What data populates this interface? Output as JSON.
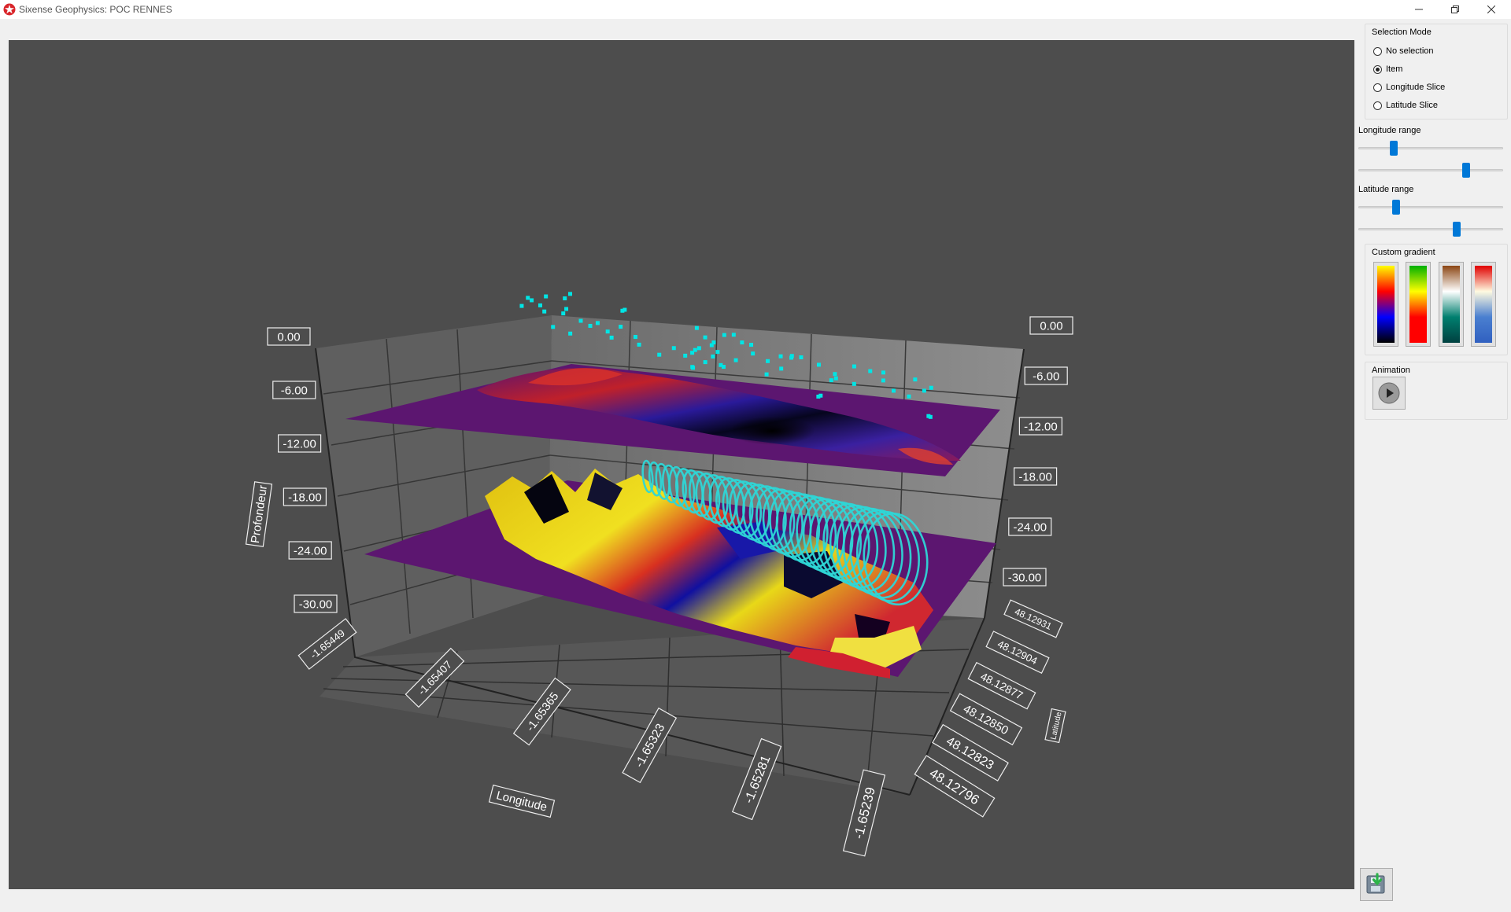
{
  "window": {
    "title": "Sixense Geophysics: POC RENNES"
  },
  "selection": {
    "title": "Selection Mode",
    "options": [
      {
        "label": "No selection",
        "checked": false
      },
      {
        "label": "Item",
        "checked": true
      },
      {
        "label": "Longitude Slice",
        "checked": false
      },
      {
        "label": "Latitude Slice",
        "checked": false
      }
    ]
  },
  "longitude_range": {
    "label": "Longitude range"
  },
  "latitude_range": {
    "label": "Latitude range"
  },
  "gradient": {
    "title": "Custom gradient",
    "swatches": [
      {
        "name": "gradient-hot",
        "colors": [
          "#ffff00",
          "#ff0000",
          "#0000ff",
          "#000000"
        ]
      },
      {
        "name": "gradient-green-red",
        "colors": [
          "#00b000",
          "#ffff00",
          "#ff0000",
          "#ff0000"
        ]
      },
      {
        "name": "gradient-brown-teal",
        "colors": [
          "#8b4513",
          "#ffffff",
          "#007f6f",
          "#004040"
        ]
      },
      {
        "name": "gradient-red-blue",
        "colors": [
          "#e00000",
          "#fffae0",
          "#4a7fd0",
          "#3060c0"
        ]
      }
    ]
  },
  "animation": {
    "title": "Animation"
  },
  "chart_data": {
    "type": "surface3d",
    "title": "",
    "axes": {
      "x": {
        "label": "Longitude",
        "ticks": [
          "-1.65449",
          "-1.65407",
          "-1.65365",
          "-1.65323",
          "-1.65281",
          "-1.65239"
        ]
      },
      "y": {
        "label": "Profondeur",
        "ticks": [
          "0.00",
          "-6.00",
          "-12.00",
          "-18.00",
          "-24.00",
          "-30.00"
        ],
        "range": [
          -30,
          0
        ]
      },
      "z": {
        "label": "Latitude",
        "ticks": [
          "48.12931",
          "48.12904",
          "48.12877",
          "48.12850",
          "48.12823",
          "48.12796"
        ]
      }
    },
    "series": [
      {
        "type": "surface",
        "colors": [
          "#ffff00",
          "#ff0000",
          "#0000ff",
          "#000000"
        ]
      },
      {
        "type": "surface",
        "colors": [
          "#ffff00",
          "#ff0000",
          "#0000ff",
          "#000000"
        ]
      },
      {
        "type": "scatter",
        "color": "#00e5e5"
      },
      {
        "type": "helix",
        "color": "#2ed6d6"
      }
    ]
  }
}
